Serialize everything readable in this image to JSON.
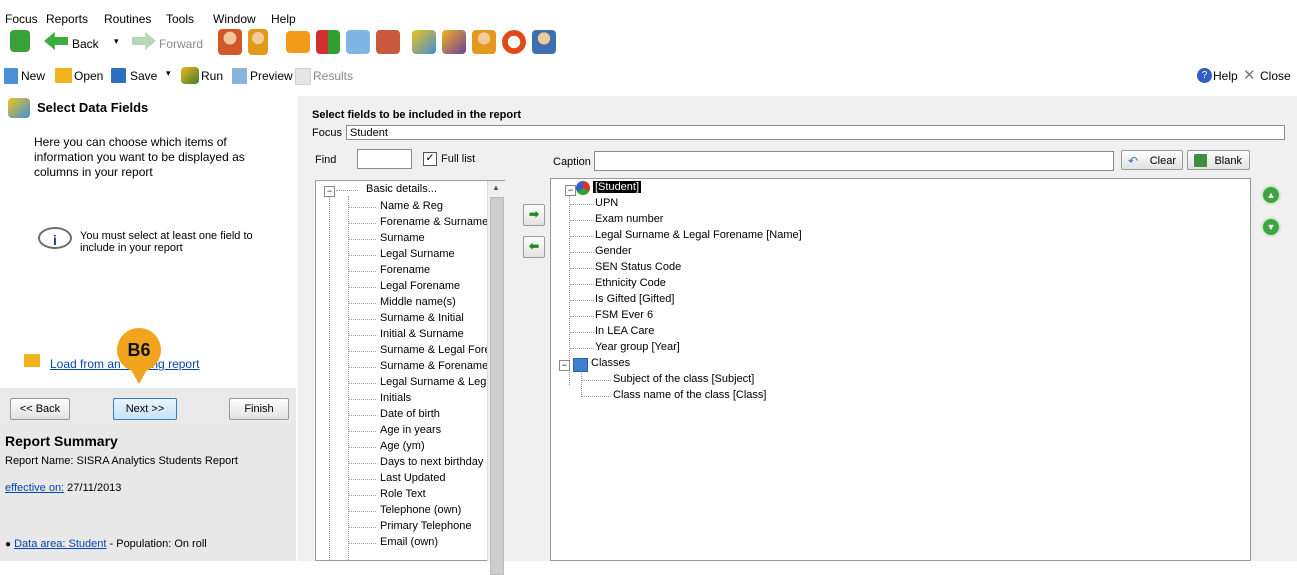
{
  "menu": [
    "Focus",
    "Reports",
    "Routines",
    "Tools",
    "Window",
    "Help"
  ],
  "toolbar1": {
    "back_label": "Back",
    "forward_label": "Forward"
  },
  "toolbar2": {
    "new_label": "New",
    "open_label": "Open",
    "save_label": "Save",
    "run_label": "Run",
    "preview_label": "Preview",
    "results_label": "Results",
    "help_label": "Help",
    "close_label": "Close"
  },
  "left": {
    "title": "Select Data Fields",
    "description": "Here you can choose which items of information you want to be displayed as columns in your report",
    "note": "You must select at least one field to include in your report",
    "load_link": "Load from an existing report",
    "badge": "B6",
    "back_label": "<< Back",
    "next_label": "Next >>",
    "finish_label": "Finish"
  },
  "summary": {
    "title": "Report Summary",
    "report_name": "Report Name: SISRA Analytics Students Report",
    "effective_link": "effective on:",
    "effective_date": " 27/11/2013",
    "data_area_link": "Data area: Student",
    "population": " - Population: On roll"
  },
  "right": {
    "heading": "Select fields to be included in the report",
    "focus_label": "Focus",
    "focus_value": "Student",
    "find_label": "Find",
    "full_list_label": "Full list",
    "caption_label": "Caption",
    "clear_label": "Clear",
    "blank_label": "Blank"
  },
  "available_fields": {
    "group": "Basic details...",
    "items": [
      "Name & Reg",
      "Forename & Surname",
      "Surname",
      "Legal Surname",
      "Forename",
      "Legal Forename",
      "Middle name(s)",
      "Surname & Initial",
      "Initial & Surname",
      "Surname & Legal Forer",
      "Surname & Forename",
      "Legal Surname & Lega",
      "Initials",
      "Date of birth",
      "Age in years",
      "Age (ym)",
      "Days to next birthday",
      "Last Updated",
      "Role Text",
      "Telephone (own)",
      "Primary Telephone",
      "Email (own)"
    ]
  },
  "selected_fields": {
    "root": "[Student]",
    "items": [
      "UPN",
      "Exam number",
      "Legal Surname & Legal Forename [Name]",
      "Gender",
      "SEN Status Code",
      "Ethnicity Code",
      "Is Gifted [Gifted]",
      "FSM Ever 6",
      "In LEA Care",
      "Year group [Year]"
    ],
    "classes_group": "Classes",
    "class_items": [
      "Subject of the class [Subject]",
      "Class name of the class [Class]"
    ]
  }
}
